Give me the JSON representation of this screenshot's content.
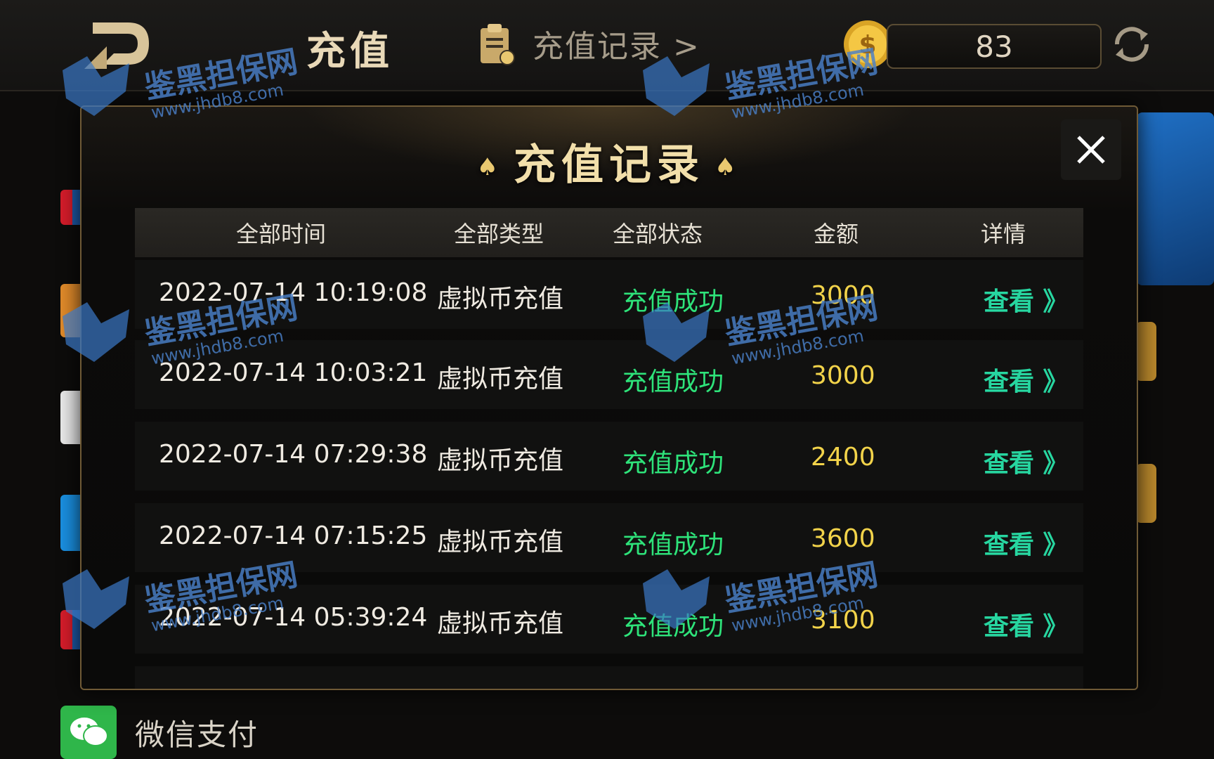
{
  "topbar": {
    "title": "充值",
    "records_link": "充值记录  >",
    "balance": "83",
    "colors": {
      "accent_gold": "#e9c870",
      "brand_green": "#2fb64a"
    }
  },
  "sidebar": {
    "wechat_label": "微信支付"
  },
  "modal": {
    "title": "充值记录",
    "columns": [
      "全部时间",
      "全部类型",
      "全部状态",
      "金额",
      "详情"
    ],
    "rows": [
      {
        "time": "2022-07-14 10:19:08",
        "type": "虚拟币充值",
        "status": "充值成功",
        "amount": "3000",
        "detail": "查看 》"
      },
      {
        "time": "2022-07-14 10:03:21",
        "type": "虚拟币充值",
        "status": "充值成功",
        "amount": "3000",
        "detail": "查看 》"
      },
      {
        "time": "2022-07-14 07:29:38",
        "type": "虚拟币充值",
        "status": "充值成功",
        "amount": "2400",
        "detail": "查看 》"
      },
      {
        "time": "2022-07-14 07:15:25",
        "type": "虚拟币充值",
        "status": "充值成功",
        "amount": "3600",
        "detail": "查看 》"
      },
      {
        "time": "2022-07-14 05:39:24",
        "type": "虚拟币充值",
        "status": "充值成功",
        "amount": "3100",
        "detail": "查看 》"
      }
    ]
  },
  "watermark": {
    "text": "鉴黑担保网",
    "url": "www.jhdb8.com"
  }
}
